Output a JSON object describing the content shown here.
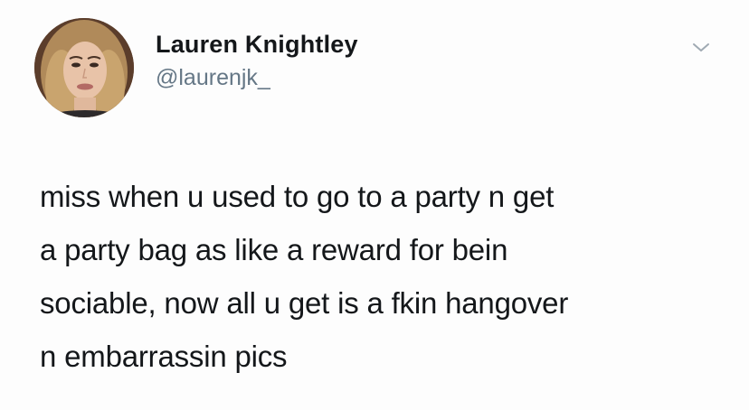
{
  "author": {
    "display_name": "Lauren Knightley",
    "handle": "@laurenjk_",
    "avatar_icon": "profile-photo"
  },
  "menu": {
    "icon": "chevron-down-icon"
  },
  "tweet": {
    "text": "miss when u used to go to a party n get\na party bag as like a reward for bein\nsociable, now all u get is a fkin hangover\nn embarrassin pics"
  },
  "colors": {
    "text": "#14171a",
    "secondary": "#657786",
    "background": "#fdfdfd"
  }
}
